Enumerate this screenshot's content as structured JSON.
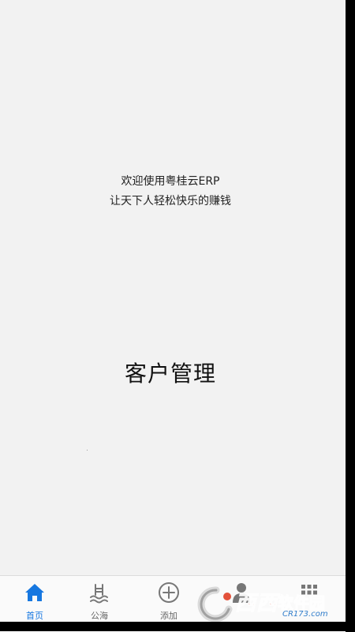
{
  "welcome": {
    "line1": "欢迎使用粤桂云ERP",
    "line2": "让天下人轻松快乐的赚钱"
  },
  "page_title": "客户管理",
  "tabs": [
    {
      "label": "首页",
      "icon": "home-icon",
      "active": true
    },
    {
      "label": "公海",
      "icon": "sea-icon",
      "active": false
    },
    {
      "label": "添加",
      "icon": "plus-circle-icon",
      "active": false
    },
    {
      "label": "",
      "icon": "person-icon",
      "active": false
    },
    {
      "label": "",
      "icon": "grid-icon",
      "active": false
    }
  ],
  "watermark": {
    "brand": "西西",
    "suffix": "软件园",
    "url": "CR173.com"
  },
  "colors": {
    "accent": "#1677e0",
    "icon_inactive": "#777777",
    "background": "#f2f2f2"
  }
}
